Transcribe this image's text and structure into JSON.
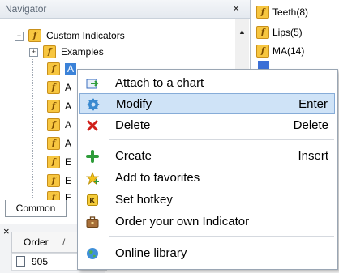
{
  "navigator": {
    "title": "Navigator",
    "close": "×",
    "tree": {
      "root_label": "Custom Indicators",
      "examples_label": "Examples",
      "hidden_item_prefixes": [
        "A",
        "A",
        "A",
        "A",
        "A",
        "E",
        "E",
        "E"
      ]
    },
    "tab_common": "Common"
  },
  "toolbox": {
    "close": "×",
    "col_order": "Order",
    "sort_sep": "/",
    "row_order": "905"
  },
  "right_panel": {
    "items": [
      "Teeth(8)",
      "Lips(5)",
      "MA(14)"
    ]
  },
  "context_menu": {
    "items": [
      {
        "label": "Attach to a chart",
        "shortcut": "",
        "icon": "attach-chart-icon"
      },
      {
        "label": "Modify",
        "shortcut": "Enter",
        "icon": "gear-icon"
      },
      {
        "label": "Delete",
        "shortcut": "Delete",
        "icon": "delete-x-icon"
      },
      {
        "label": "Create",
        "shortcut": "Insert",
        "icon": "plus-icon"
      },
      {
        "label": "Add to favorites",
        "shortcut": "",
        "icon": "star-icon"
      },
      {
        "label": "Set hotkey",
        "shortcut": "",
        "icon": "hotkey-k-icon"
      },
      {
        "label": "Order your own Indicator",
        "shortcut": "",
        "icon": "briefcase-icon"
      },
      {
        "label": "Online library",
        "shortcut": "",
        "icon": "globe-icon"
      }
    ]
  },
  "colors": {
    "selection": "#cfe3f7",
    "indicator_icon": "#f7c640",
    "delete_red": "#d0201a",
    "create_green": "#2e9c3a"
  }
}
